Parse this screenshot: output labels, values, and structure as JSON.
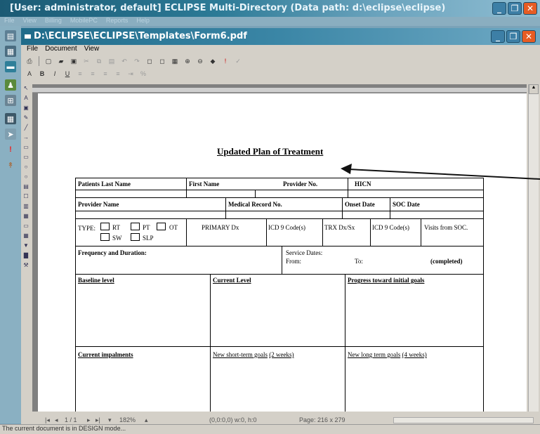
{
  "app": {
    "title": "[User: administrator, default]  ECLIPSE Multi-Directory (Data path: d:\\eclipse\\eclipse)",
    "menu": [
      "File",
      "View",
      "Billing",
      "MobilePC",
      "Reports",
      "Help"
    ]
  },
  "document_window": {
    "title": "D:\\ECLIPSE\\ECLIPSE\\Templates\\Form6.pdf",
    "menu": [
      "File",
      "Document",
      "View"
    ]
  },
  "form": {
    "title": "Updated Plan of Treatment",
    "row1": {
      "patients_last_name": "Patients Last Name",
      "first_name": "First Name",
      "provider_no": "Provider No.",
      "hicn": "HICN"
    },
    "row2": {
      "provider_name": "Provider Name",
      "medical_record_no": "Medical Record No.",
      "onset_date": "Onset Date",
      "soc_date": "SOC Date"
    },
    "row3": {
      "type_label": "TYPE:",
      "types": [
        "RT",
        "PT",
        "OT",
        "SW",
        "SLP"
      ],
      "primary_dx": "PRIMARY Dx",
      "icd9_code_1": "ICD 9  Code(s)",
      "trx_dx_sx": "TRX Dx/Sx",
      "icd9_code_2": "ICD 9 Code(s)",
      "visits_from_soc": "Visits from SOC."
    },
    "row4": {
      "frequency_duration": "Frequency and Duration:",
      "service_dates": "Service Dates:",
      "from": "From:",
      "to": "To:",
      "completed": "(completed)"
    },
    "row5": {
      "baseline_level": "Baseline level",
      "current_level": "Current Level",
      "progress": "Progress toward initial goals"
    },
    "row6": {
      "current_impairments": "Current impalments",
      "short_term_goals": "New short-term goals",
      "short_term_weeks": "(2 weeks)",
      "long_term_goals": "New long term goals",
      "long_term_weeks": "(4 weeks)"
    }
  },
  "bottom_bar": {
    "page_counter": "1 / 1",
    "zoom": "182%",
    "coords": "(0,0:0,0) w:0, h:0",
    "page_size": "Page: 216 x 279"
  },
  "status": "The current document is in DESIGN mode..."
}
